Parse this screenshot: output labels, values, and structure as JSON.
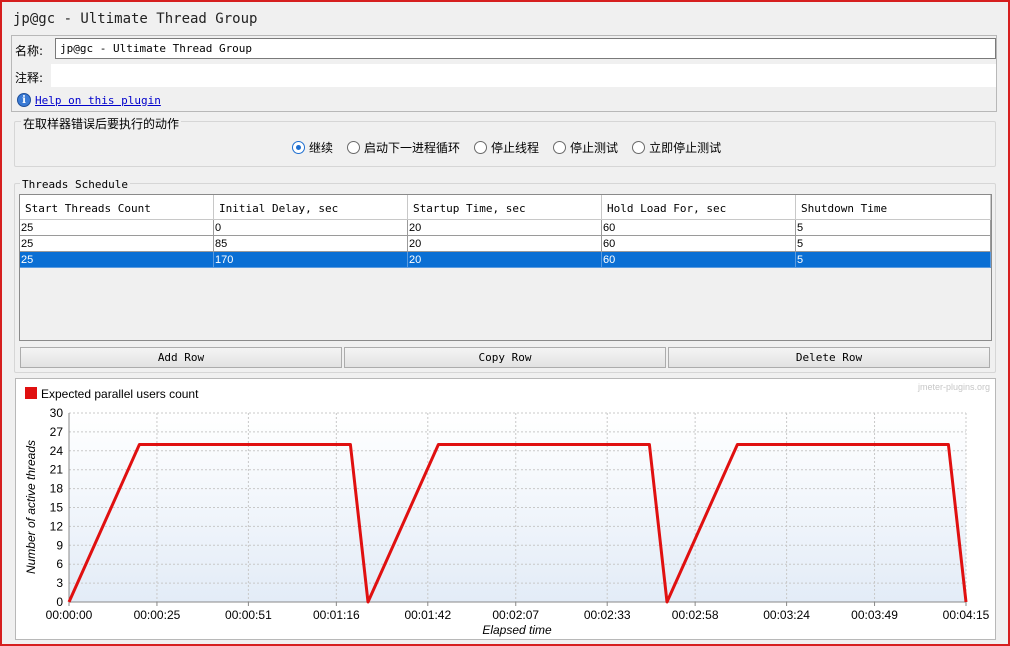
{
  "window": {
    "title": "jp@gc - Ultimate Thread Group"
  },
  "form": {
    "name_label": "名称:",
    "name_value": "jp@gc - Ultimate Thread Group",
    "comment_label": "注释:",
    "comment_value": "",
    "help_icon": "info-icon",
    "help_link": "Help on this plugin"
  },
  "error_action": {
    "legend": "在取样器错误后要执行的动作",
    "options": [
      {
        "label": "继续",
        "selected": true
      },
      {
        "label": "启动下一进程循环",
        "selected": false
      },
      {
        "label": "停止线程",
        "selected": false
      },
      {
        "label": "停止测试",
        "selected": false
      },
      {
        "label": "立即停止测试",
        "selected": false
      }
    ]
  },
  "schedule": {
    "legend": "Threads Schedule",
    "columns": [
      "Start Threads Count",
      "Initial Delay, sec",
      "Startup Time, sec",
      "Hold Load For, sec",
      "Shutdown Time"
    ],
    "rows": [
      [
        "25",
        "0",
        "20",
        "60",
        "5"
      ],
      [
        "25",
        "85",
        "20",
        "60",
        "5"
      ],
      [
        "25",
        "170",
        "20",
        "60",
        "5"
      ]
    ],
    "selected_row": 2,
    "buttons": {
      "add": "Add Row",
      "copy": "Copy Row",
      "delete": "Delete Row"
    }
  },
  "colors": {
    "series": "#e01010",
    "selection": "#0a6fd4",
    "frame": "#d61f1f"
  },
  "chart_data": {
    "type": "line",
    "title": "",
    "watermark": "jmeter-plugins.org",
    "xlabel": "Elapsed time",
    "ylabel": "Number of active threads",
    "ylim": [
      0,
      30
    ],
    "yticks": [
      0,
      3,
      6,
      9,
      12,
      15,
      18,
      21,
      24,
      27,
      30
    ],
    "xlim": [
      0,
      255
    ],
    "xticks": [
      {
        "t": 0,
        "label": "00:00:00"
      },
      {
        "t": 25,
        "label": "00:00:25"
      },
      {
        "t": 51,
        "label": "00:00:51"
      },
      {
        "t": 76,
        "label": "00:01:16"
      },
      {
        "t": 102,
        "label": "00:01:42"
      },
      {
        "t": 127,
        "label": "00:02:07"
      },
      {
        "t": 153,
        "label": "00:02:33"
      },
      {
        "t": 178,
        "label": "00:02:58"
      },
      {
        "t": 204,
        "label": "00:03:24"
      },
      {
        "t": 229,
        "label": "00:03:49"
      },
      {
        "t": 255,
        "label": "00:04:15"
      }
    ],
    "grid": true,
    "legend_position": "top-left",
    "series": [
      {
        "name": "Expected parallel users count",
        "x": [
          0,
          20,
          80,
          85,
          105,
          165,
          170,
          190,
          250,
          255
        ],
        "y": [
          0,
          25,
          25,
          0,
          25,
          25,
          0,
          25,
          25,
          0
        ]
      }
    ]
  }
}
